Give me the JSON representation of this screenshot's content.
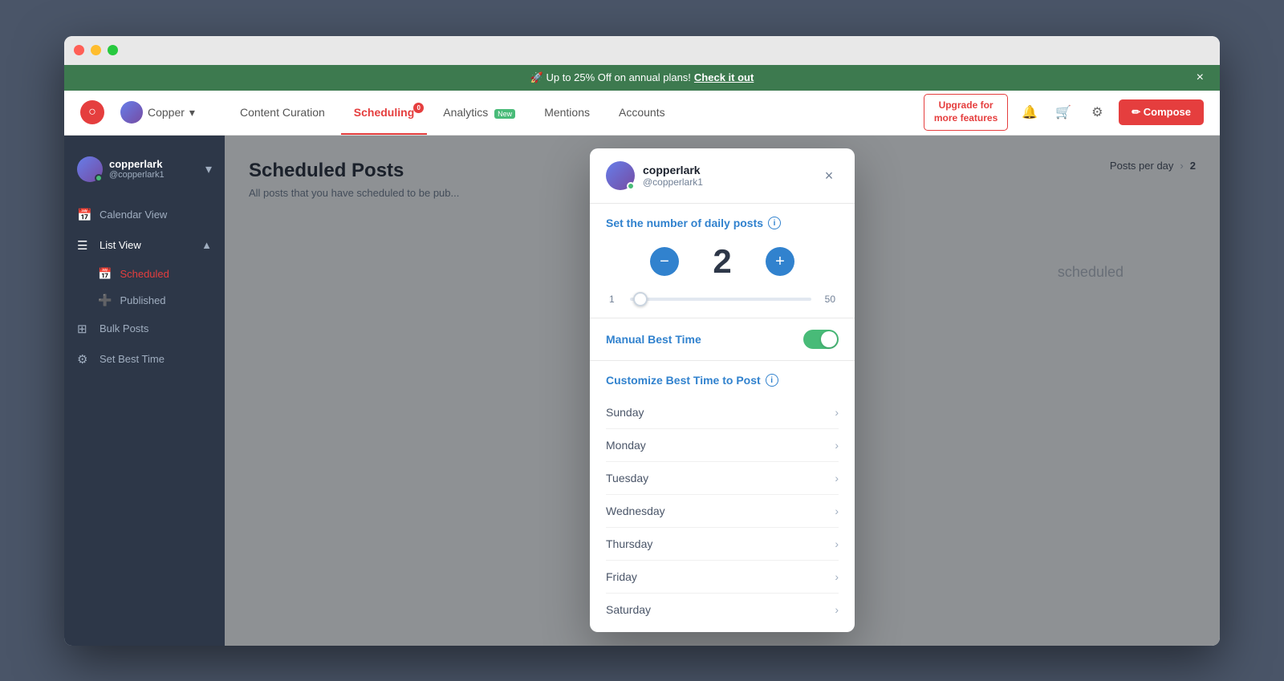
{
  "browser": {
    "traffic_lights": [
      "red",
      "yellow",
      "green"
    ]
  },
  "banner": {
    "text": "🚀 Up to 25% Off on annual plans!",
    "link_text": "Check it out",
    "close": "×"
  },
  "header": {
    "logo": "○",
    "account": {
      "name": "Copper",
      "chevron": "▾"
    },
    "nav": [
      {
        "label": "Content Curation",
        "active": false,
        "badge": ""
      },
      {
        "label": "Scheduling",
        "active": true,
        "badge": "0"
      },
      {
        "label": "Analytics",
        "active": false,
        "new_badge": "New"
      },
      {
        "label": "Mentions",
        "active": false
      },
      {
        "label": "Accounts",
        "active": false
      }
    ],
    "upgrade_line1": "Upgrade for",
    "upgrade_line2": "more features",
    "compose": "✏ Compose"
  },
  "sidebar": {
    "account": {
      "name": "copperlark",
      "handle": "@copperlark1"
    },
    "items": [
      {
        "label": "Calendar View",
        "icon": "📅"
      },
      {
        "label": "List View",
        "icon": "☰",
        "expanded": true
      },
      {
        "label": "Scheduled",
        "sub": true,
        "active": true,
        "icon": "📅"
      },
      {
        "label": "Published",
        "sub": true,
        "icon": "➕"
      },
      {
        "label": "Bulk Posts",
        "icon": "⊞"
      },
      {
        "label": "Set Best Time",
        "icon": "⚙"
      }
    ]
  },
  "main": {
    "title": "Scheduled Posts",
    "subtitle": "All posts that you have scheduled to be pub...",
    "posts_per_day_label": "Posts per day",
    "posts_per_day_value": "2"
  },
  "modal": {
    "account_name": "copperlark",
    "account_handle": "@copperlark1",
    "close": "×",
    "daily_posts_title": "Set the number of daily posts",
    "counter_value": "2",
    "minus": "−",
    "plus": "+",
    "slider_min": "1",
    "slider_max": "50",
    "manual_best_time_label": "Manual Best Time",
    "customize_title": "Customize Best Time to Post",
    "days": [
      {
        "label": "Sunday"
      },
      {
        "label": "Monday"
      },
      {
        "label": "Tuesday"
      },
      {
        "label": "Wednesday"
      },
      {
        "label": "Thursday"
      },
      {
        "label": "Friday"
      },
      {
        "label": "Saturday"
      }
    ]
  }
}
